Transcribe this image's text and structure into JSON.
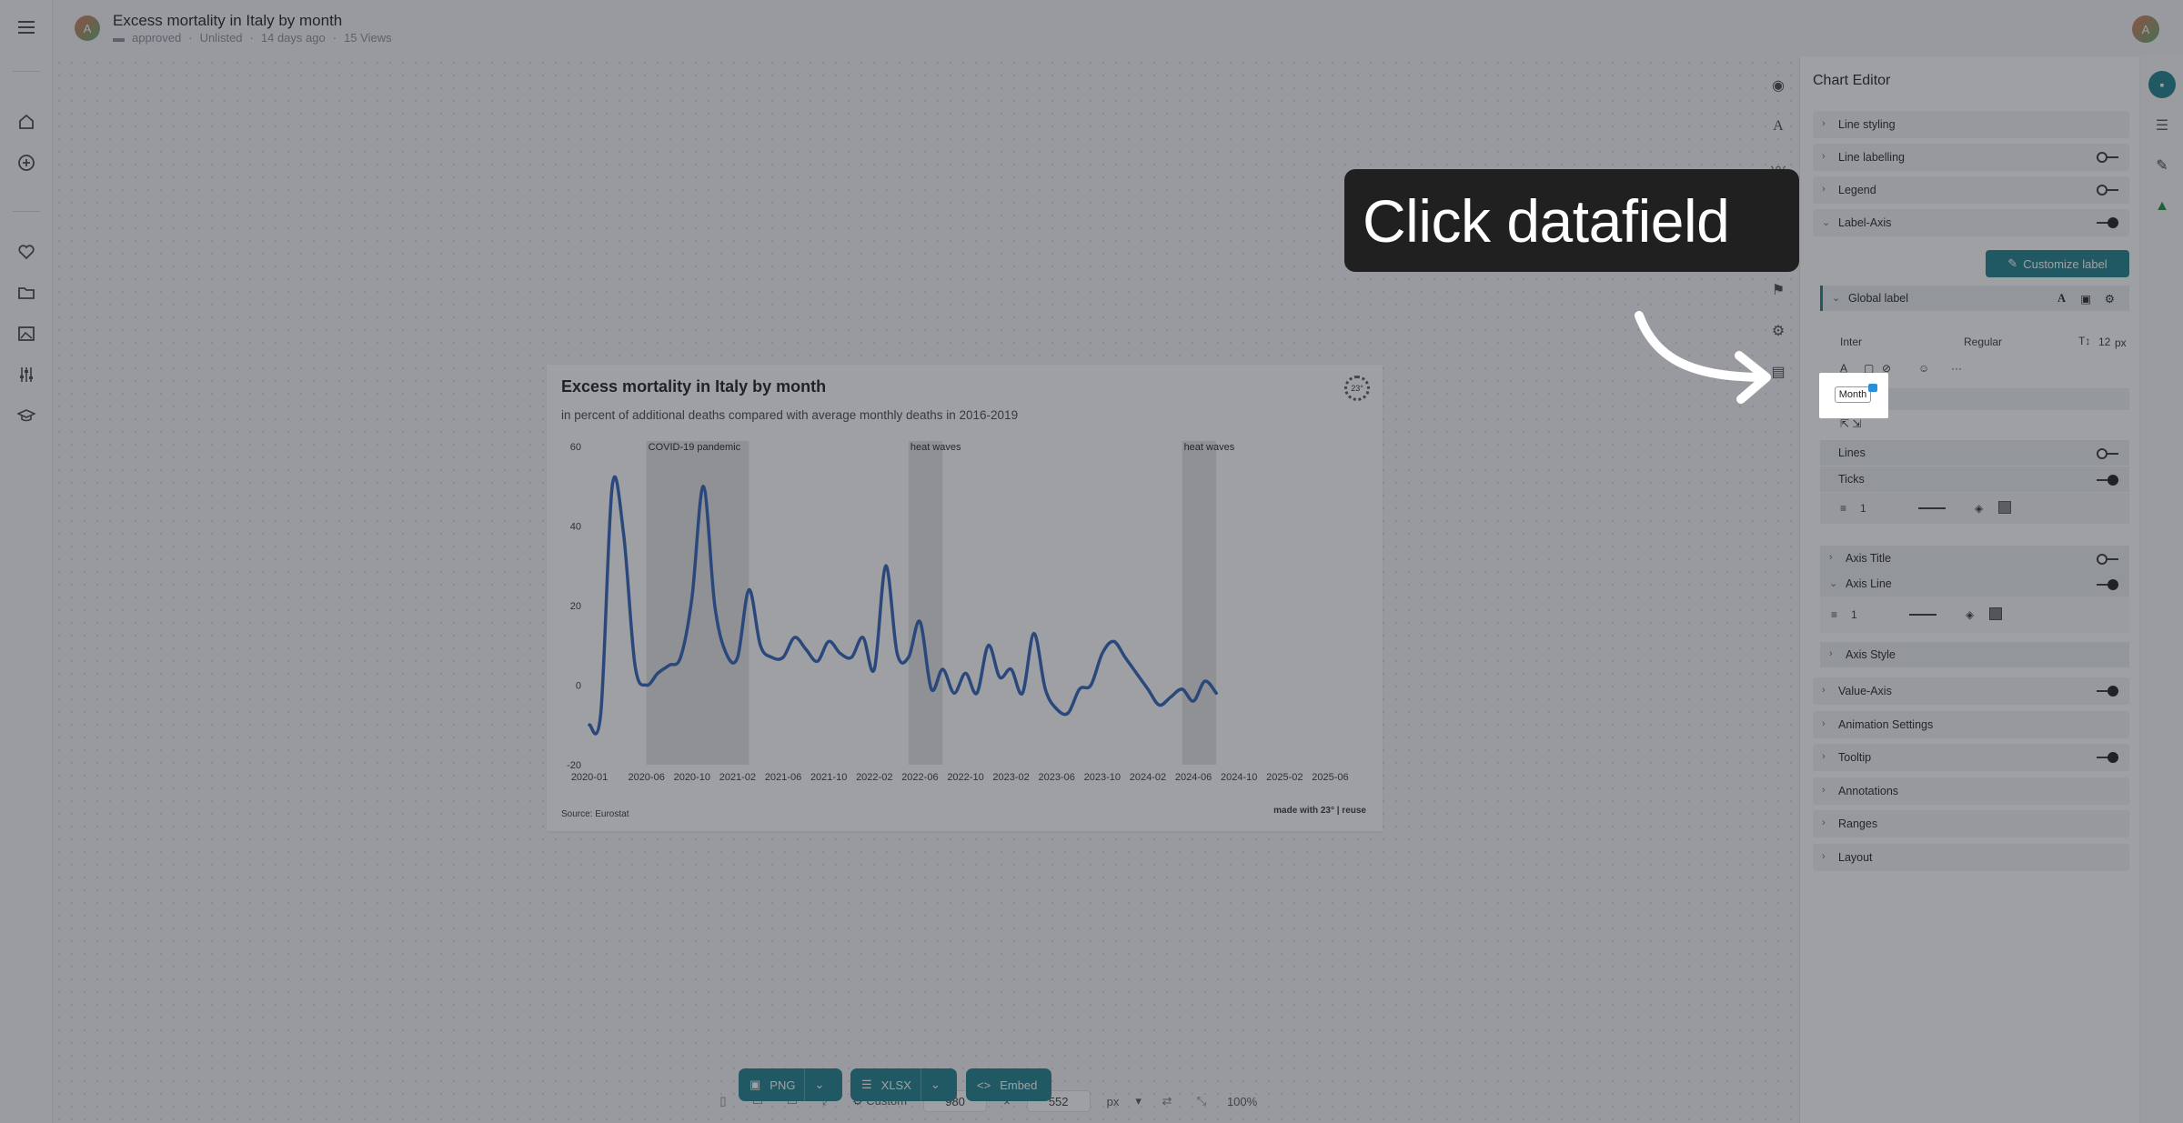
{
  "header": {
    "title": "Excess mortality in Italy by month",
    "status": "approved",
    "visibility": "Unlisted",
    "age": "14 days ago",
    "views": "15 Views",
    "avatar_letter": "A"
  },
  "chart": {
    "title": "Excess mortality in Italy by month",
    "subtitle": "in percent of additional deaths compared with average monthly deaths in 2016-2019",
    "source": "Source: Eurostat",
    "made_with": "made with 23° | reuse",
    "logo_text": "23°"
  },
  "chart_data": {
    "type": "line",
    "title": "Excess mortality in Italy by month",
    "subtitle": "in percent of additional deaths compared with average monthly deaths in 2016-2019",
    "xlabel": "",
    "ylabel": "",
    "ylim": [
      -20,
      60
    ],
    "yticks": [
      "-20",
      "0",
      "20",
      "40",
      "60"
    ],
    "xticks": [
      "2020-01",
      "2020-06",
      "2020-10",
      "2021-02",
      "2021-06",
      "2021-10",
      "2022-02",
      "2022-06",
      "2022-10",
      "2023-02",
      "2023-06",
      "2023-10",
      "2024-02",
      "2024-06",
      "2024-10",
      "2025-02",
      "2025-06"
    ],
    "color": "#2c5fb8",
    "x": [
      "2020-01",
      "2020-02",
      "2020-03",
      "2020-04",
      "2020-05",
      "2020-06",
      "2020-07",
      "2020-08",
      "2020-09",
      "2020-10",
      "2020-11",
      "2020-12",
      "2021-01",
      "2021-02",
      "2021-03",
      "2021-04",
      "2021-05",
      "2021-06",
      "2021-07",
      "2021-08",
      "2021-09",
      "2021-10",
      "2021-11",
      "2021-12",
      "2022-01",
      "2022-02",
      "2022-03",
      "2022-04",
      "2022-05",
      "2022-06",
      "2022-07",
      "2022-08",
      "2022-09",
      "2022-10",
      "2022-11",
      "2022-12",
      "2023-01",
      "2023-02",
      "2023-03",
      "2023-04",
      "2023-05",
      "2023-06",
      "2023-07",
      "2023-08",
      "2023-09",
      "2023-10",
      "2023-11",
      "2023-12",
      "2024-01",
      "2024-02",
      "2024-03",
      "2024-04",
      "2024-05",
      "2024-06",
      "2024-07",
      "2024-08",
      "2024-09",
      "2024-10",
      "2024-11",
      "2024-12",
      "2025-01",
      "2025-02",
      "2025-03",
      "2025-04",
      "2025-05",
      "2025-06",
      "2025-07"
    ],
    "values": [
      -10,
      -7,
      50,
      38,
      5,
      0,
      3,
      5,
      7,
      22,
      50,
      20,
      8,
      7,
      24,
      10,
      7,
      7,
      12,
      9,
      6,
      11,
      8,
      7,
      12,
      4,
      30,
      8,
      7,
      16,
      -1,
      4,
      -2,
      3,
      -2,
      10,
      2,
      4,
      -2,
      13,
      -1,
      -6,
      -7,
      -1,
      0,
      8,
      11,
      7,
      3,
      -1,
      -5,
      -3,
      -1,
      -4,
      1,
      -2
    ],
    "ranges": [
      {
        "label": "COVID-19 pandemic",
        "from": "2020-06",
        "to": "2021-03"
      },
      {
        "label": "heat waves",
        "from": "2022-05",
        "to": "2022-08"
      },
      {
        "label": "heat waves",
        "from": "2024-05",
        "to": "2024-08"
      }
    ],
    "grid": false,
    "legend": "none"
  },
  "toolbar": {
    "preset": "Custom",
    "width": "980",
    "height": "552",
    "unit": "px",
    "zoom": "100%",
    "png": "PNG",
    "xlsx": "XLSX",
    "embed": "Embed"
  },
  "editor": {
    "title": "Chart Editor",
    "sections": {
      "line_styling": "Line styling",
      "line_labelling": "Line labelling",
      "legend": "Legend",
      "label_axis": "Label-Axis",
      "value_axis": "Value-Axis",
      "animation": "Animation Settings",
      "tooltip": "Tooltip",
      "annotations": "Annotations",
      "ranges": "Ranges",
      "layout": "Layout"
    },
    "customize_label": "Customize label",
    "global_label": "Global label",
    "font": "Inter",
    "weight": "Regular",
    "size": "12",
    "size_unit": "px",
    "lines": "Lines",
    "ticks": "Ticks",
    "tick_width": "1",
    "axis_title": "Axis Title",
    "axis_line": "Axis Line",
    "axis_line_width": "1",
    "axis_style": "Axis Style"
  },
  "overlay": {
    "instruction": "Click datafield",
    "field_tag": "Month"
  }
}
